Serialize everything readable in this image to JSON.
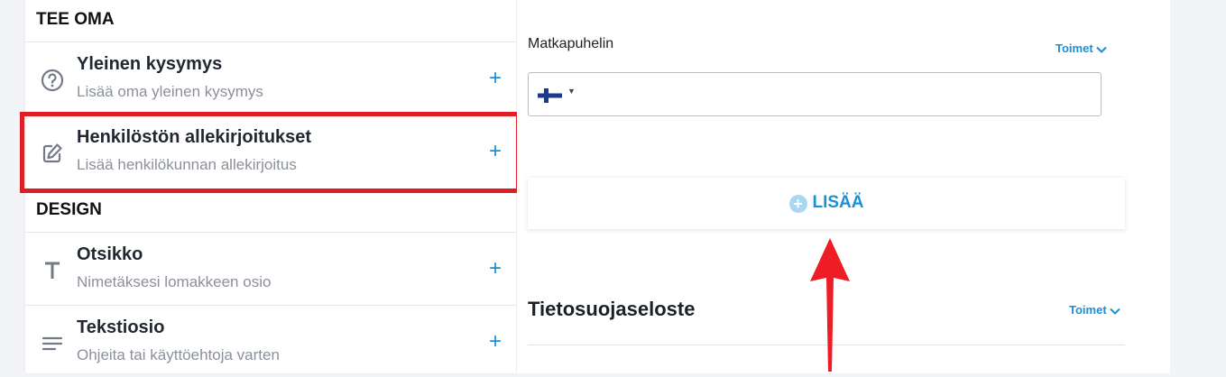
{
  "sidebar": {
    "section_custom": "TEE OMA",
    "section_design": "DESIGN",
    "items": [
      {
        "title": "Yleinen kysymys",
        "desc": "Lisää oma yleinen kysymys",
        "icon": "question-circle-icon"
      },
      {
        "title": "Henkilöstön allekirjoitukset",
        "desc": "Lisää henkilökunnan allekirjoitus",
        "icon": "edit-signature-icon"
      },
      {
        "title": "Otsikko",
        "desc": "Nimetäksesi lomakkeen osio",
        "icon": "text-heading-icon"
      },
      {
        "title": "Tekstiosio",
        "desc": "Ohjeita tai käyttöehtoja varten",
        "icon": "text-lines-icon"
      }
    ],
    "plus": "+"
  },
  "main": {
    "phone_label": "Matkapuhelin",
    "actions_label": "Toimet",
    "phone_value": "",
    "add_button": "LISÄÄ",
    "privacy_title": "Tietosuojaseloste"
  },
  "colors": {
    "accent": "#1a8fd6",
    "highlight": "#e01e26",
    "arrow": "#ee1c24"
  }
}
